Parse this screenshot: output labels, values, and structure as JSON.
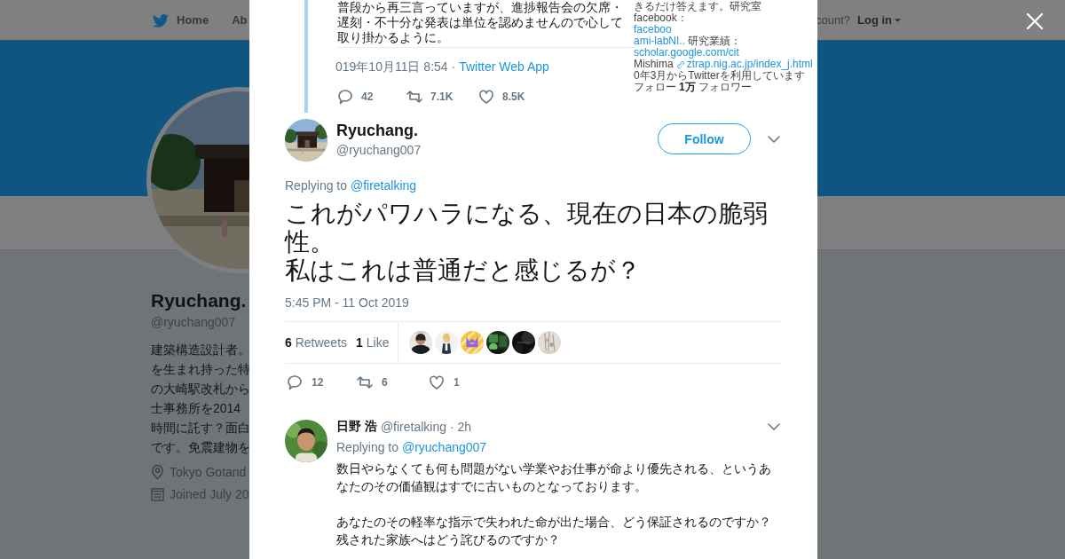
{
  "background_page": {
    "nav": {
      "home": "Home",
      "about": "Ab",
      "account_prompt": "count?",
      "login": "Log in"
    },
    "profile": {
      "avatar": {
        "kind": "picture"
      },
      "name": "Ryuchang.",
      "handle": "@ryuchang007",
      "bio_lines": [
        "建築構造設計者。",
        "を生まれ持った特",
        "の大崎駅改札から",
        "士事務所を2014",
        "時間に託す？面白",
        "です。免震建物を"
      ],
      "location": "Tokyo Gotand",
      "joined": "Joined July 20"
    }
  },
  "quoted_screenshot": {
    "text_lines": [
      "普段から再三言っていますが、進捗報告会の欠席・",
      "遅刻・不十分な発表は単位を認めませんので心して",
      "取り掛かるように。"
    ],
    "timestamp": "019年10月11日 8:54 ·",
    "source": "Twitter Web App",
    "replies": "42",
    "retweets": "7.1K",
    "likes": "8.5K",
    "side_lines": [
      [
        {
          "kind": "plain",
          "text": "きるだけ答えます。研究室facebook："
        },
        {
          "kind": "link",
          "text": "faceboo"
        }
      ],
      [
        {
          "kind": "link",
          "text": "ami-labNI.."
        },
        {
          "kind": "plain",
          "text": " 研究業績："
        },
        {
          "kind": "link",
          "text": "scholar.google.com/cit"
        }
      ],
      [
        {
          "kind": "plain",
          "text": "Mishima"
        },
        {
          "kind": "url",
          "text": "ztrap.nig.ac.jp/index_j.html"
        }
      ],
      [
        {
          "kind": "plain",
          "text": "0年3月からTwitterを利用しています"
        }
      ],
      [
        {
          "kind": "plain",
          "text": "フォロー"
        },
        {
          "kind": "bold",
          "text": "1万"
        },
        {
          "kind": "plain",
          "text": "フォロワー"
        }
      ]
    ]
  },
  "tweet": {
    "avatar": {
      "kind": "picture"
    },
    "name": "Ryuchang.",
    "handle": "@ryuchang007",
    "follow_button": "Follow",
    "replying_prefix": "Replying to",
    "replying_to": "@firetalking",
    "paragraphs": [
      "これがパワハラになる、現在の日本の脆弱性。",
      "私はこれは普通だと感じるが？"
    ],
    "time": "5:45 PM - 11 Oct 2019",
    "retweet_count": "6",
    "retweet_label": "Retweets",
    "like_count": "1",
    "like_label": "Like",
    "engagers": [
      {
        "kind": "picture"
      },
      {
        "kind": "picture"
      },
      {
        "kind": "picture"
      },
      {
        "kind": "picture"
      },
      {
        "kind": "picture"
      },
      {
        "kind": "picture"
      }
    ],
    "replies": "12",
    "retweets": "6",
    "likes": "1"
  },
  "reply": {
    "avatar": {
      "kind": "picture"
    },
    "name": "日野 浩",
    "handle": "@firetalking",
    "age": "· 2h",
    "replying_prefix": "Replying to",
    "replying_to": "@ryuchang007",
    "paragraphs": [
      [
        "数日やらなくても何も問題がない学業やお仕事が命より優先される、というあ",
        "なたのその価値観はすでに古いものとなっております。"
      ],
      [
        "あなたのその軽率な指示で失われた命が出た場合、どう保証されるのですか？",
        "残された家族へはどう詫びるのですか？"
      ]
    ]
  },
  "close_button": {
    "kind": "close"
  }
}
